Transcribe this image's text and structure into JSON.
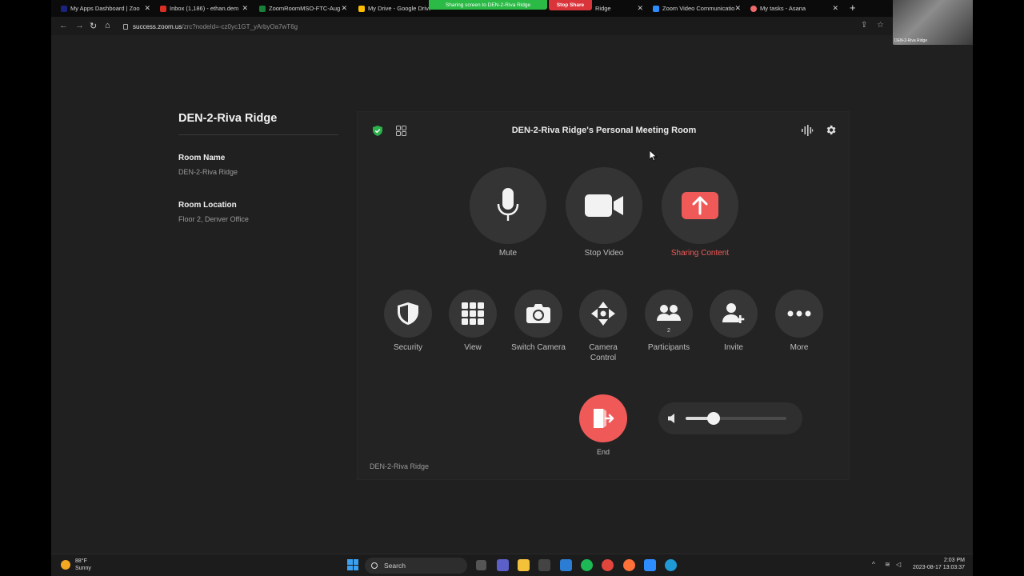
{
  "browser": {
    "tabs": [
      {
        "title": "My Apps Dashboard | Zoo",
        "color": "#1a237e"
      },
      {
        "title": "Inbox (1,186) - ethan.dem",
        "color": "#d93025"
      },
      {
        "title": "ZoomRoomMSO-FTC-Aug",
        "color": "#188038"
      },
      {
        "title": "My Drive - Google Drive",
        "color": "#fbbc04"
      },
      {
        "title": "Ridge",
        "color": "#2d8cff"
      },
      {
        "title": "Zoom Video Communicatio",
        "color": "#2d8cff"
      },
      {
        "title": "My tasks - Asana",
        "color": "#f06a6a"
      }
    ],
    "new_tab": "+",
    "url_host": "success.zoom.us",
    "url_path": "/zrc?nodeId=-cz0yc1GT_yArbyOa7wT6g"
  },
  "sharing": {
    "banner": "Sharing screen to DEN-2-Riva Ridge",
    "stop_label": "Stop Share"
  },
  "camera_preview_label": "DEN-2-Riva Ridge",
  "sidebar": {
    "title": "DEN-2-Riva Ridge",
    "room_name_label": "Room Name",
    "room_name_value": "DEN-2-Riva Ridge",
    "room_location_label": "Room Location",
    "room_location_value": "Floor 2, Denver Office"
  },
  "controller": {
    "meeting_title": "DEN-2-Riva Ridge's Personal Meeting Room",
    "primary": {
      "mute": "Mute",
      "stop_video": "Stop Video",
      "sharing": "Sharing Content"
    },
    "secondary": {
      "security": "Security",
      "view": "View",
      "switch_camera": "Switch Camera",
      "camera_control_1": "Camera",
      "camera_control_2": "Control",
      "participants": "Participants",
      "participants_count": "2",
      "invite": "Invite",
      "more": "More"
    },
    "end": "End",
    "volume_level": 0.28,
    "footer": "DEN-2-Riva Ridge",
    "colors": {
      "accent_red": "#ef5a59",
      "shield_green": "#2bb24c"
    }
  },
  "taskbar": {
    "temperature": "88°F",
    "condition": "Sunny",
    "search": "Search",
    "time": "2:03 PM",
    "date": "2023-08-17 13:03:37"
  }
}
